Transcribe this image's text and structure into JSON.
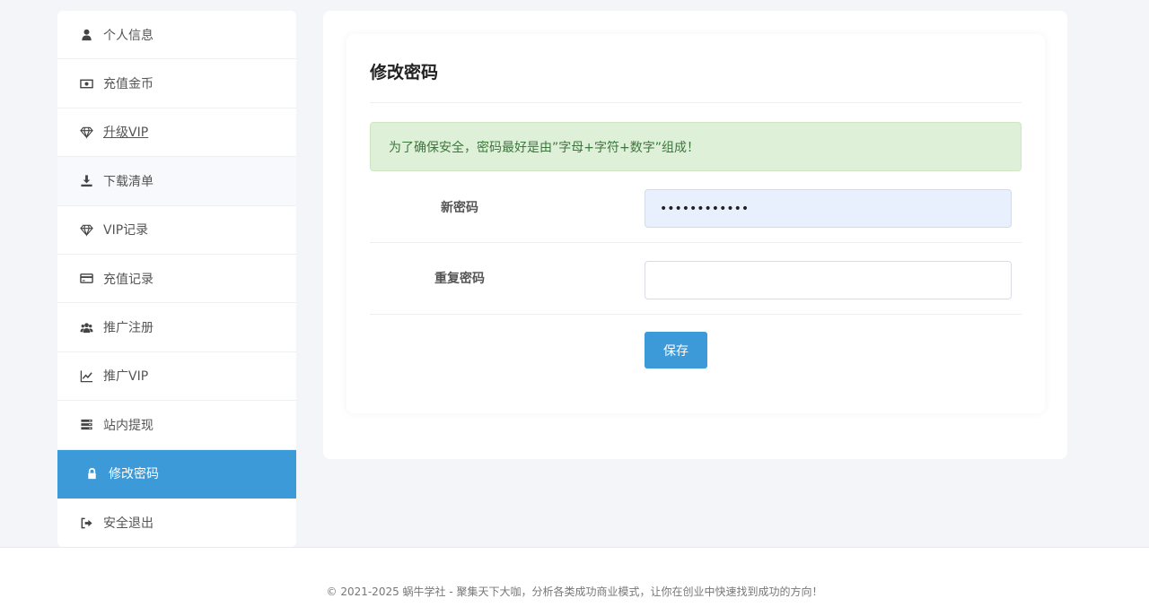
{
  "sidebar": {
    "items": [
      {
        "label": "个人信息",
        "icon": "user-icon"
      },
      {
        "label": "充值金币",
        "icon": "money-icon"
      },
      {
        "label": "升级VIP",
        "icon": "diamond-icon"
      },
      {
        "label": "下载清单",
        "icon": "download-icon"
      },
      {
        "label": "VIP记录",
        "icon": "diamond-icon"
      },
      {
        "label": "充值记录",
        "icon": "credit-card-icon"
      },
      {
        "label": "推广注册",
        "icon": "users-icon"
      },
      {
        "label": "推广VIP",
        "icon": "line-chart-icon"
      },
      {
        "label": "站内提现",
        "icon": "server-icon"
      },
      {
        "label": "修改密码",
        "icon": "lock-icon"
      },
      {
        "label": "安全退出",
        "icon": "sign-out-icon"
      }
    ],
    "active_label": "修改密码",
    "accent_color": "#3d9ad9"
  },
  "form": {
    "title": "修改密码",
    "alert_text": "为了确保安全，密码最好是由”字母+字符+数字”组成！",
    "new_password_label": "新密码",
    "new_password_value": "••••••••••••",
    "repeat_password_label": "重复密码",
    "repeat_password_value": "",
    "save_label": "保存"
  },
  "footer": {
    "text": "© 2021-2025 蜗牛学社  - 聚集天下大咖，分析各类成功商业模式，让你在创业中快速找到成功的方向！"
  }
}
